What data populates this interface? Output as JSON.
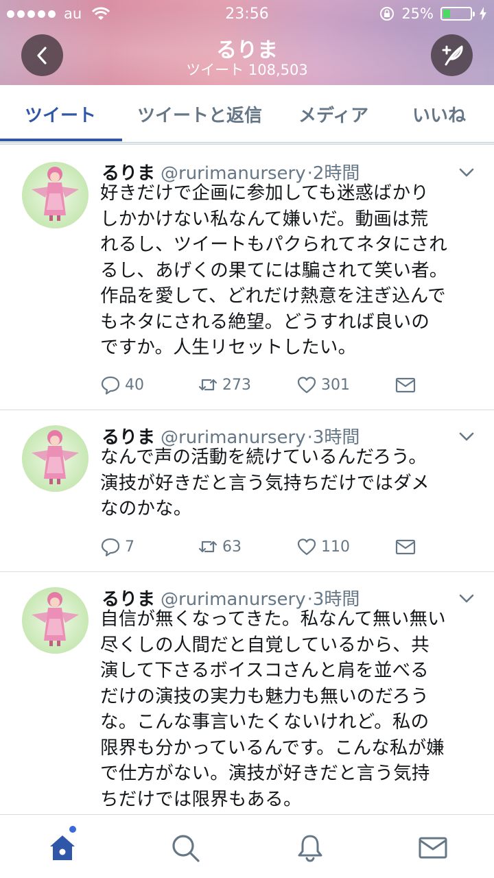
{
  "status_bar": {
    "carrier": "au",
    "time": "23:56",
    "battery_percent": "25%",
    "battery_level": 0.25,
    "signal_dots": 5
  },
  "header": {
    "title": "るりま",
    "subtitle": "ツイート 108,503"
  },
  "tabs": [
    {
      "label": "ツイート",
      "active": true
    },
    {
      "label": "ツイートと返信",
      "active": false
    },
    {
      "label": "メディア",
      "active": false
    },
    {
      "label": "いいね",
      "active": false
    }
  ],
  "tweets": [
    {
      "name": "るりま",
      "handle": "@rurimanursery",
      "time": "2時間",
      "lines": [
        "好きだけで企画に参加しても迷惑ばかり",
        "しかかけない私なんて嫌いだ。動画は荒",
        "れるし、ツイートもパクられてネタにされ",
        "るし、あげくの果てには騙されて笑い者。",
        "作品を愛して、どれだけ熱意を注ぎ込んで",
        "もネタにされる絶望。どうすれば良いの",
        "ですか。人生リセットしたい。"
      ],
      "replies": "40",
      "retweets": "273",
      "likes": "301"
    },
    {
      "name": "るりま",
      "handle": "@rurimanursery",
      "time": "3時間",
      "lines": [
        "なんで声の活動を続けているんだろう。",
        "演技が好きだと言う気持ちだけではダメ",
        "なのかな。"
      ],
      "replies": "7",
      "retweets": "63",
      "likes": "110"
    },
    {
      "name": "るりま",
      "handle": "@rurimanursery",
      "time": "3時間",
      "lines": [
        "自信が無くなってきた。私なんて無い無い",
        "尽くしの人間だと自覚しているから、共",
        "演して下さるボイスコさんと肩を並べる",
        "だけの演技の実力も魅力も無いのだろう",
        "な。こんな事言いたくないけれど。私の",
        "限界も分かっているんです。こんな私が嫌",
        "で仕方がない。演技が好きだと言う気持",
        "ちだけでは限界もある。"
      ]
    }
  ],
  "bottom_nav": {
    "items": [
      "home-icon",
      "search-icon",
      "bell-icon",
      "mail-icon"
    ],
    "active_color": "#2f56a7",
    "inactive_color": "#657786"
  }
}
